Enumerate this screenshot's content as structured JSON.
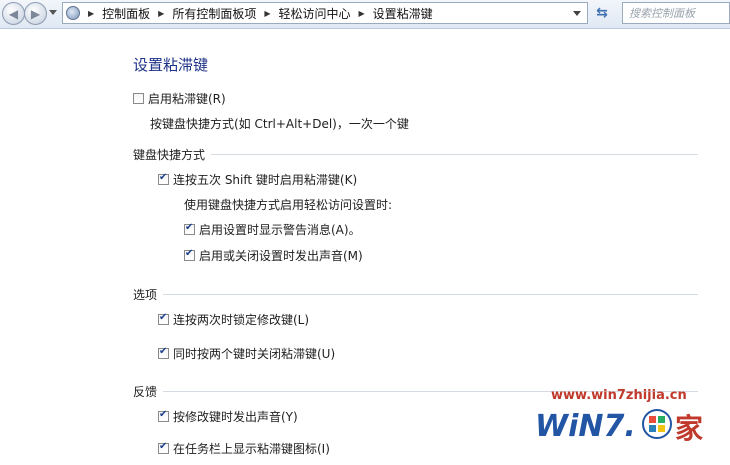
{
  "nav": {
    "breadcrumbs": [
      "控制面板",
      "所有控制面板项",
      "轻松访问中心",
      "设置粘滞键"
    ],
    "search_placeholder": "搜索控制面板"
  },
  "page_title": "设置粘滞键",
  "main": {
    "enable_sticky": {
      "label": "启用粘滞键(R)",
      "checked": false
    },
    "enable_sticky_desc": "按键盘快捷方式(如 Ctrl+Alt+Del)，一次一个键",
    "sections": {
      "keyboard_shortcut": {
        "heading": "键盘快捷方式",
        "shift_five": {
          "label": "连按五次 Shift 键时启用粘滞键(K)",
          "checked": true
        },
        "sub_heading": "使用键盘快捷方式启用轻松访问设置时:",
        "show_warning": {
          "label": "启用设置时显示警告消息(A)。",
          "checked": true
        },
        "play_sound": {
          "label": "启用或关闭设置时发出声音(M)",
          "checked": true
        }
      },
      "options": {
        "heading": "选项",
        "lock_modifier": {
          "label": "连按两次时锁定修改键(L)",
          "checked": true
        },
        "two_keys_off": {
          "label": "同时按两个键时关闭粘滞键(U)",
          "checked": true
        }
      },
      "feedback": {
        "heading": "反馈",
        "modifier_sound": {
          "label": "按修改键时发出声音(Y)",
          "checked": true
        },
        "taskbar_icon": {
          "label": "在任务栏上显示粘滞键图标(I)",
          "checked": true
        }
      }
    }
  },
  "watermark": {
    "url": "www.win7zhijia.cn",
    "logo_text": "WiN7.之家"
  },
  "colors": {
    "title": "#1e3287",
    "watermark": "#c0392b",
    "logo_blue": "#2255a4"
  }
}
